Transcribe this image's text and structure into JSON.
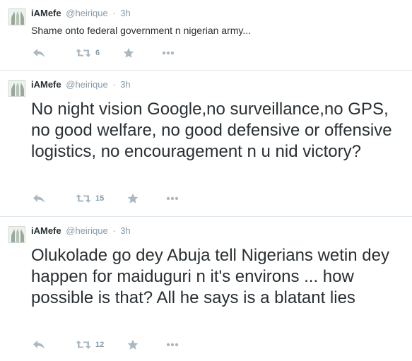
{
  "tweets": [
    {
      "name": "iAMefe",
      "handle": "@heirique",
      "separator": "·",
      "time": "3h",
      "text": "Shame onto federal government n nigerian army...",
      "retweet_count": "6",
      "icons": {
        "reply": "reply-icon",
        "retweet": "retweet-icon",
        "favorite": "star-icon",
        "more": "more-icon"
      }
    },
    {
      "name": "iAMefe",
      "handle": "@heirique",
      "separator": "·",
      "time": "3h",
      "text": "No night vision Google,no surveillance,no GPS, no good welfare, no good defensive or offensive logistics, no encouragement n u nid victory?",
      "retweet_count": "15",
      "icons": {
        "reply": "reply-icon",
        "retweet": "retweet-icon",
        "favorite": "star-icon",
        "more": "more-icon"
      }
    },
    {
      "name": "iAMefe",
      "handle": "@heirique",
      "separator": "·",
      "time": "3h",
      "text": "Olukolade go dey Abuja tell Nigerians wetin dey happen for maiduguri n it's environs ... how possible is that? All he says is a blatant lies",
      "retweet_count": "12",
      "icons": {
        "reply": "reply-icon",
        "retweet": "retweet-icon",
        "favorite": "star-icon",
        "more": "more-icon"
      }
    }
  ],
  "colors": {
    "text": "#292f33",
    "muted": "#8899a6",
    "icon": "#aab8c2",
    "divider": "#e1e8ed"
  }
}
